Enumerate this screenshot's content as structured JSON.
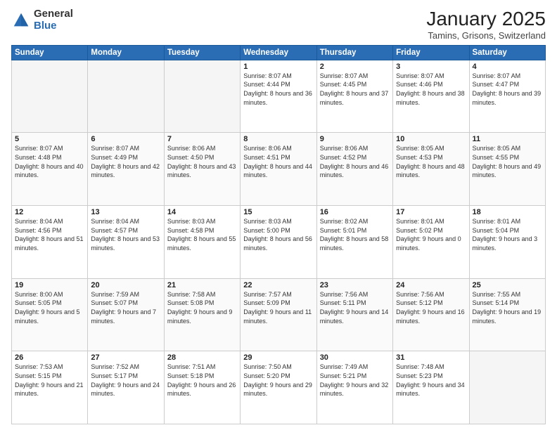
{
  "logo": {
    "general": "General",
    "blue": "Blue"
  },
  "header": {
    "title": "January 2025",
    "subtitle": "Tamins, Grisons, Switzerland"
  },
  "weekdays": [
    "Sunday",
    "Monday",
    "Tuesday",
    "Wednesday",
    "Thursday",
    "Friday",
    "Saturday"
  ],
  "weeks": [
    [
      {
        "day": "",
        "sunrise": "",
        "sunset": "",
        "daylight": ""
      },
      {
        "day": "",
        "sunrise": "",
        "sunset": "",
        "daylight": ""
      },
      {
        "day": "",
        "sunrise": "",
        "sunset": "",
        "daylight": ""
      },
      {
        "day": "1",
        "sunrise": "Sunrise: 8:07 AM",
        "sunset": "Sunset: 4:44 PM",
        "daylight": "Daylight: 8 hours and 36 minutes."
      },
      {
        "day": "2",
        "sunrise": "Sunrise: 8:07 AM",
        "sunset": "Sunset: 4:45 PM",
        "daylight": "Daylight: 8 hours and 37 minutes."
      },
      {
        "day": "3",
        "sunrise": "Sunrise: 8:07 AM",
        "sunset": "Sunset: 4:46 PM",
        "daylight": "Daylight: 8 hours and 38 minutes."
      },
      {
        "day": "4",
        "sunrise": "Sunrise: 8:07 AM",
        "sunset": "Sunset: 4:47 PM",
        "daylight": "Daylight: 8 hours and 39 minutes."
      }
    ],
    [
      {
        "day": "5",
        "sunrise": "Sunrise: 8:07 AM",
        "sunset": "Sunset: 4:48 PM",
        "daylight": "Daylight: 8 hours and 40 minutes."
      },
      {
        "day": "6",
        "sunrise": "Sunrise: 8:07 AM",
        "sunset": "Sunset: 4:49 PM",
        "daylight": "Daylight: 8 hours and 42 minutes."
      },
      {
        "day": "7",
        "sunrise": "Sunrise: 8:06 AM",
        "sunset": "Sunset: 4:50 PM",
        "daylight": "Daylight: 8 hours and 43 minutes."
      },
      {
        "day": "8",
        "sunrise": "Sunrise: 8:06 AM",
        "sunset": "Sunset: 4:51 PM",
        "daylight": "Daylight: 8 hours and 44 minutes."
      },
      {
        "day": "9",
        "sunrise": "Sunrise: 8:06 AM",
        "sunset": "Sunset: 4:52 PM",
        "daylight": "Daylight: 8 hours and 46 minutes."
      },
      {
        "day": "10",
        "sunrise": "Sunrise: 8:05 AM",
        "sunset": "Sunset: 4:53 PM",
        "daylight": "Daylight: 8 hours and 48 minutes."
      },
      {
        "day": "11",
        "sunrise": "Sunrise: 8:05 AM",
        "sunset": "Sunset: 4:55 PM",
        "daylight": "Daylight: 8 hours and 49 minutes."
      }
    ],
    [
      {
        "day": "12",
        "sunrise": "Sunrise: 8:04 AM",
        "sunset": "Sunset: 4:56 PM",
        "daylight": "Daylight: 8 hours and 51 minutes."
      },
      {
        "day": "13",
        "sunrise": "Sunrise: 8:04 AM",
        "sunset": "Sunset: 4:57 PM",
        "daylight": "Daylight: 8 hours and 53 minutes."
      },
      {
        "day": "14",
        "sunrise": "Sunrise: 8:03 AM",
        "sunset": "Sunset: 4:58 PM",
        "daylight": "Daylight: 8 hours and 55 minutes."
      },
      {
        "day": "15",
        "sunrise": "Sunrise: 8:03 AM",
        "sunset": "Sunset: 5:00 PM",
        "daylight": "Daylight: 8 hours and 56 minutes."
      },
      {
        "day": "16",
        "sunrise": "Sunrise: 8:02 AM",
        "sunset": "Sunset: 5:01 PM",
        "daylight": "Daylight: 8 hours and 58 minutes."
      },
      {
        "day": "17",
        "sunrise": "Sunrise: 8:01 AM",
        "sunset": "Sunset: 5:02 PM",
        "daylight": "Daylight: 9 hours and 0 minutes."
      },
      {
        "day": "18",
        "sunrise": "Sunrise: 8:01 AM",
        "sunset": "Sunset: 5:04 PM",
        "daylight": "Daylight: 9 hours and 3 minutes."
      }
    ],
    [
      {
        "day": "19",
        "sunrise": "Sunrise: 8:00 AM",
        "sunset": "Sunset: 5:05 PM",
        "daylight": "Daylight: 9 hours and 5 minutes."
      },
      {
        "day": "20",
        "sunrise": "Sunrise: 7:59 AM",
        "sunset": "Sunset: 5:07 PM",
        "daylight": "Daylight: 9 hours and 7 minutes."
      },
      {
        "day": "21",
        "sunrise": "Sunrise: 7:58 AM",
        "sunset": "Sunset: 5:08 PM",
        "daylight": "Daylight: 9 hours and 9 minutes."
      },
      {
        "day": "22",
        "sunrise": "Sunrise: 7:57 AM",
        "sunset": "Sunset: 5:09 PM",
        "daylight": "Daylight: 9 hours and 11 minutes."
      },
      {
        "day": "23",
        "sunrise": "Sunrise: 7:56 AM",
        "sunset": "Sunset: 5:11 PM",
        "daylight": "Daylight: 9 hours and 14 minutes."
      },
      {
        "day": "24",
        "sunrise": "Sunrise: 7:56 AM",
        "sunset": "Sunset: 5:12 PM",
        "daylight": "Daylight: 9 hours and 16 minutes."
      },
      {
        "day": "25",
        "sunrise": "Sunrise: 7:55 AM",
        "sunset": "Sunset: 5:14 PM",
        "daylight": "Daylight: 9 hours and 19 minutes."
      }
    ],
    [
      {
        "day": "26",
        "sunrise": "Sunrise: 7:53 AM",
        "sunset": "Sunset: 5:15 PM",
        "daylight": "Daylight: 9 hours and 21 minutes."
      },
      {
        "day": "27",
        "sunrise": "Sunrise: 7:52 AM",
        "sunset": "Sunset: 5:17 PM",
        "daylight": "Daylight: 9 hours and 24 minutes."
      },
      {
        "day": "28",
        "sunrise": "Sunrise: 7:51 AM",
        "sunset": "Sunset: 5:18 PM",
        "daylight": "Daylight: 9 hours and 26 minutes."
      },
      {
        "day": "29",
        "sunrise": "Sunrise: 7:50 AM",
        "sunset": "Sunset: 5:20 PM",
        "daylight": "Daylight: 9 hours and 29 minutes."
      },
      {
        "day": "30",
        "sunrise": "Sunrise: 7:49 AM",
        "sunset": "Sunset: 5:21 PM",
        "daylight": "Daylight: 9 hours and 32 minutes."
      },
      {
        "day": "31",
        "sunrise": "Sunrise: 7:48 AM",
        "sunset": "Sunset: 5:23 PM",
        "daylight": "Daylight: 9 hours and 34 minutes."
      },
      {
        "day": "",
        "sunrise": "",
        "sunset": "",
        "daylight": ""
      }
    ]
  ]
}
